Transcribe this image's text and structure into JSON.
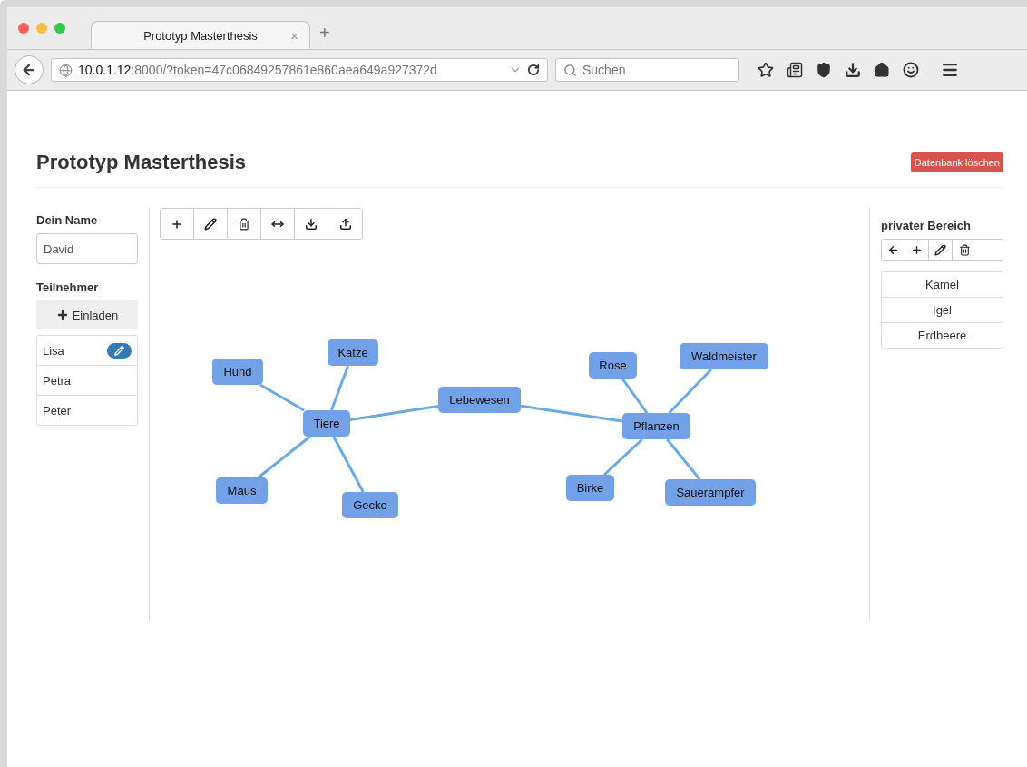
{
  "browser": {
    "tab": {
      "title": "Prototyp Masterthesis",
      "close": "×"
    },
    "new_tab": "+",
    "url": {
      "host": "10.0.1.12",
      "path": ":8000/?token=47c06849257861e860aea649a927372d"
    },
    "search": {
      "placeholder": "Suchen"
    }
  },
  "page": {
    "title": "Prototyp Masterthesis",
    "danger_button": "Datenbank löschen"
  },
  "sidebar": {
    "name_label": "Dein Name",
    "name_value": "David",
    "participants_label": "Teilnehmer",
    "invite_button": "Einladen",
    "participants": [
      {
        "name": "Lisa",
        "editing": true
      },
      {
        "name": "Petra",
        "editing": false
      },
      {
        "name": "Peter",
        "editing": false
      }
    ]
  },
  "toolbar": [
    {
      "kind": "add"
    },
    {
      "kind": "edit"
    },
    {
      "kind": "delete"
    },
    {
      "kind": "link"
    },
    {
      "kind": "download"
    },
    {
      "kind": "upload"
    }
  ],
  "graph": {
    "root": {
      "label": "Lebewesen",
      "children": [
        {
          "label": "Tiere",
          "children": [
            {
              "label": "Hund"
            },
            {
              "label": "Katze"
            },
            {
              "label": "Maus"
            },
            {
              "label": "Gecko"
            }
          ]
        },
        {
          "label": "Pflanzen",
          "children": [
            {
              "label": "Rose"
            },
            {
              "label": "Waldmeister"
            },
            {
              "label": "Birke"
            },
            {
              "label": "Sauerampfer"
            }
          ]
        }
      ]
    }
  },
  "private": {
    "title": "privater Bereich",
    "tools": [
      {
        "kind": "back"
      },
      {
        "kind": "add"
      },
      {
        "kind": "edit"
      },
      {
        "kind": "delete"
      }
    ],
    "items": [
      "Kamel",
      "Igel",
      "Erdbeere"
    ]
  }
}
